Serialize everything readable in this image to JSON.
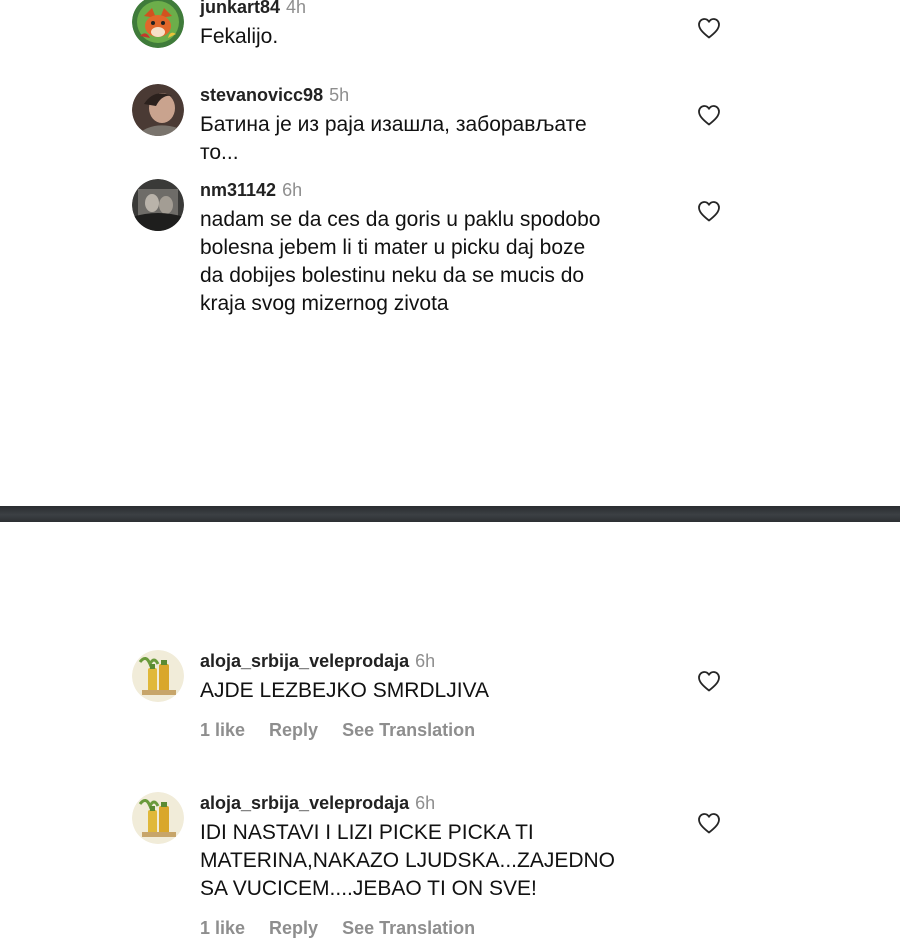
{
  "screenshot_top": {
    "comments": [
      {
        "username": "junkart84",
        "time": "4h",
        "text_lines": [
          "Fekalijo."
        ],
        "avatar_icon": "fox-avatar-icon",
        "like_icon": "heart-outline-icon"
      },
      {
        "username": "stevanovicc98",
        "time": "5h",
        "text_lines": [
          "Батина је из раја изашла, заборављате",
          "то..."
        ],
        "avatar_icon": "profile-photo-icon",
        "like_icon": "heart-outline-icon"
      },
      {
        "username": "nm31142",
        "time": "6h",
        "text_lines": [
          "nadam se da ces da goris u paklu spodobo",
          "bolesna jebem li ti mater u picku daj boze",
          "da dobijes bolestinu neku da se mucis do",
          "kraja svog mizernog zivota"
        ],
        "avatar_icon": "profile-photo-icon",
        "like_icon": "heart-outline-icon"
      }
    ]
  },
  "screenshot_bottom": {
    "comments": [
      {
        "username": "aloja_srbija_veleprodaja",
        "time": "6h",
        "text_lines": [
          "AJDE LEZBEJKO SMRDLJIVA"
        ],
        "likes": "1 like",
        "reply_label": "Reply",
        "translation_label": "See Translation",
        "avatar_icon": "aloe-bottles-avatar-icon",
        "like_icon": "heart-outline-icon"
      },
      {
        "username": "aloja_srbija_veleprodaja",
        "time": "6h",
        "text_lines": [
          "IDI NASTAVI I LIZI PICKE PICKA TI",
          "MATERINA,NAKAZO LJUDSKA...ZAJEDNO",
          "SA VUCICEM....JEBAO TI ON SVE!"
        ],
        "likes": "1 like",
        "reply_label": "Reply",
        "translation_label": "See Translation",
        "avatar_icon": "aloe-bottles-avatar-icon",
        "like_icon": "heart-outline-icon"
      }
    ]
  },
  "colors": {
    "background": "#ffffff",
    "text": "#111111",
    "muted": "#8e8e8e",
    "divider": "#36393c"
  }
}
